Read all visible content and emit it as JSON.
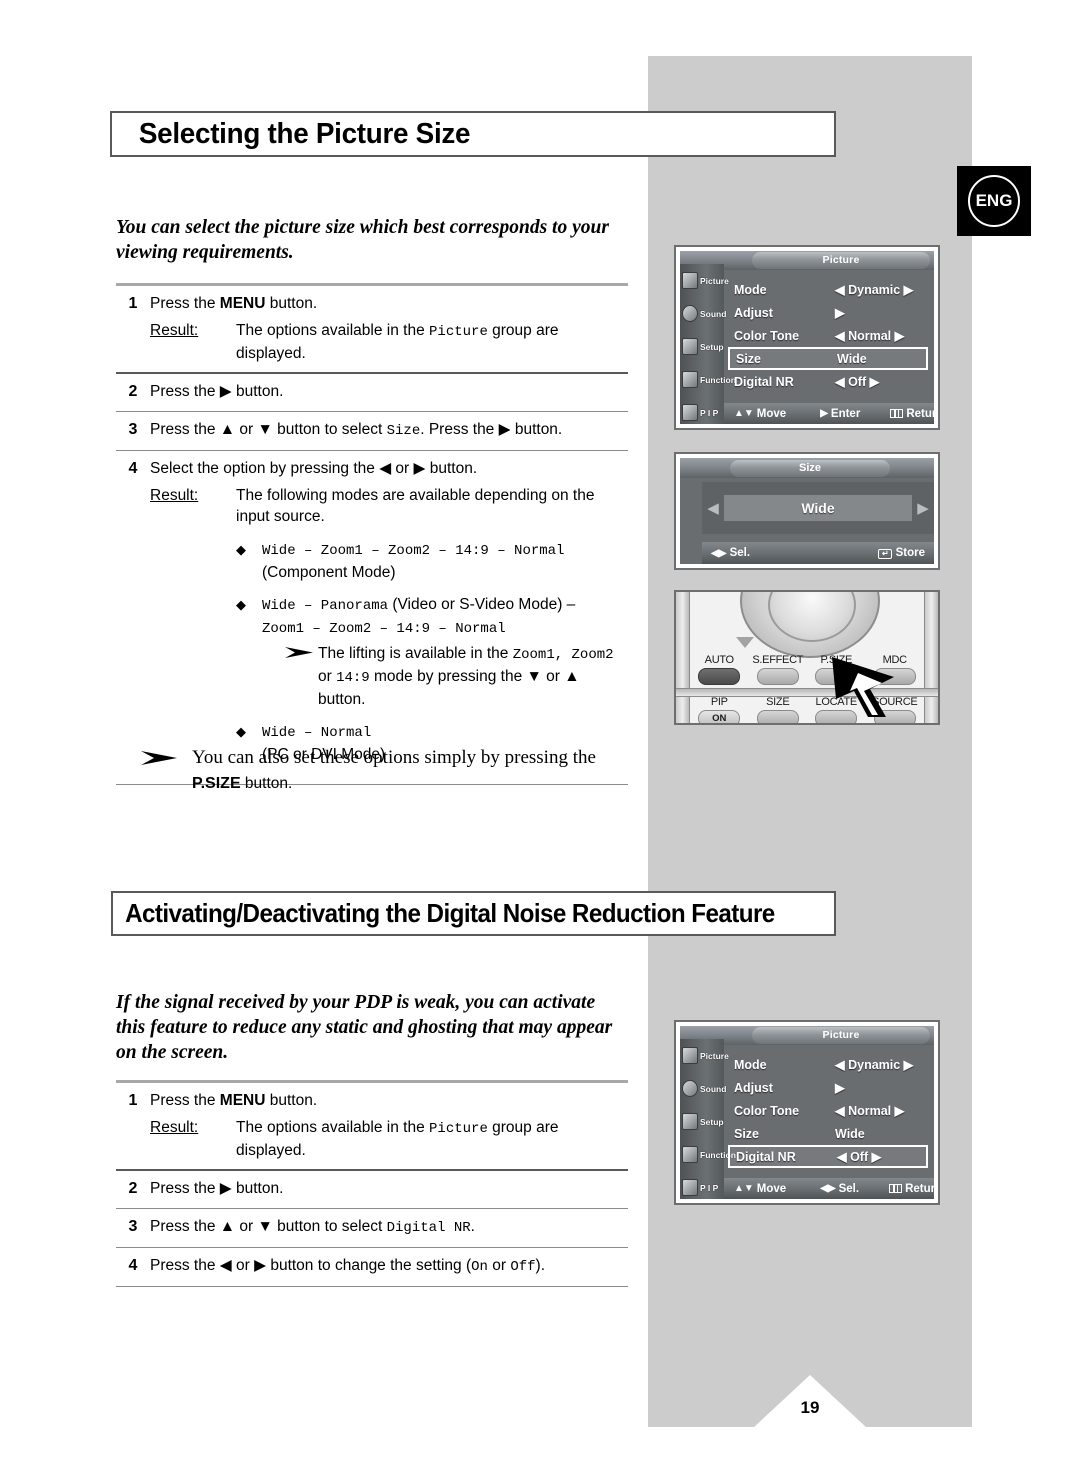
{
  "page": {
    "number": "19",
    "language_badge": "ENG"
  },
  "sections": [
    {
      "title": "Selecting the Picture Size",
      "intro": "You can select the picture size which best corresponds to your viewing requirements.",
      "steps": [
        {
          "num": "1",
          "text_parts": [
            "Press the ",
            "MENU",
            " button."
          ],
          "result_label": "Result:",
          "result_parts": [
            "The options available in the ",
            "Picture",
            " group are displayed."
          ]
        },
        {
          "num": "2",
          "text": "Press the ▶ button."
        },
        {
          "num": "3",
          "text_parts": [
            "Press the ▲ or ▼ button to select ",
            "Size",
            ". Press the ▶ button."
          ]
        },
        {
          "num": "4",
          "text": "Select the option by pressing the ◀ or ▶ button.",
          "result_label": "Result:",
          "result_text": "The following modes are available depending on the input source.",
          "bullets": [
            {
              "mono": "Wide – Zoom1 – Zoom2 – 14:9 – Normal",
              "plain": "(Component Mode)"
            },
            {
              "mono_a": "Wide – Panorama",
              "plain_a": " (Video or S-Video Mode) –",
              "mono_b": "Zoom1 – Zoom2 – 14:9 – Normal",
              "note_parts": [
                "The lifting is available in the ",
                "Zoom1, Zoom2",
                " or ",
                "14:9",
                " mode by pressing the ▼ or ▲ button."
              ]
            },
            {
              "mono": "Wide – Normal",
              "plain": "(PC or DVI Mode)"
            }
          ]
        }
      ],
      "tip": {
        "line1": "You can also set these options simply by pressing the",
        "bold": "P.SIZE",
        "line2_suffix": " button."
      }
    },
    {
      "title": "Activating/Deactivating the Digital Noise Reduction Feature",
      "intro": "If the signal received by your PDP is weak, you can activate this feature to reduce any static and ghosting that may appear on the screen.",
      "steps": [
        {
          "num": "1",
          "text_parts": [
            "Press the ",
            "MENU",
            " button."
          ],
          "result_label": "Result:",
          "result_parts": [
            "The options available in the ",
            "Picture",
            " group are displayed."
          ]
        },
        {
          "num": "2",
          "text": "Press the ▶ button."
        },
        {
          "num": "3",
          "text_parts": [
            "Press the ▲ or ▼ button to select ",
            "Digital NR",
            "."
          ]
        },
        {
          "num": "4",
          "text_parts_4": [
            "Press the ◀ or ▶ button to change the setting (",
            "On",
            " or ",
            "Off",
            ")."
          ]
        }
      ]
    }
  ],
  "osd_picture_menu_1": {
    "title": "Picture",
    "rail": [
      {
        "label": "Picture",
        "icon": "picture-icon"
      },
      {
        "label": "Sound",
        "icon": "sound-icon"
      },
      {
        "label": "Setup",
        "icon": "setup-icon"
      },
      {
        "label": "Function",
        "icon": "function-icon"
      },
      {
        "label": "P I P",
        "icon": "pip-icon"
      }
    ],
    "rows": [
      {
        "label": "Mode",
        "value": "◀  Dynamic  ▶",
        "highlight": false
      },
      {
        "label": "Adjust",
        "value": "▶",
        "highlight": false
      },
      {
        "label": "Color Tone",
        "value": "◀  Normal  ▶",
        "highlight": false
      },
      {
        "label": "Size",
        "value": "Wide",
        "highlight": true
      },
      {
        "label": "Digital NR",
        "value": "◀  Off  ▶",
        "highlight": false
      }
    ],
    "footer": {
      "move": "Move",
      "mid": "Enter",
      "mid_glyph": "▶",
      "return": "Return"
    }
  },
  "osd_size_popup": {
    "title": "Size",
    "value": "Wide",
    "arrow_left": "◀",
    "arrow_right": "▶",
    "footer_left": "Sel.",
    "footer_left_glyph": "◀▶",
    "footer_right": "Store"
  },
  "osd_picture_menu_2": {
    "title": "Picture",
    "rail": [
      {
        "label": "Picture",
        "icon": "picture-icon"
      },
      {
        "label": "Sound",
        "icon": "sound-icon"
      },
      {
        "label": "Setup",
        "icon": "setup-icon"
      },
      {
        "label": "Function",
        "icon": "function-icon"
      },
      {
        "label": "P I P",
        "icon": "pip-icon"
      }
    ],
    "rows": [
      {
        "label": "Mode",
        "value": "◀  Dynamic  ▶",
        "highlight": false
      },
      {
        "label": "Adjust",
        "value": "▶",
        "highlight": false
      },
      {
        "label": "Color Tone",
        "value": "◀  Normal  ▶",
        "highlight": false
      },
      {
        "label": "Size",
        "value": "Wide",
        "highlight": false
      },
      {
        "label": "Digital NR",
        "value": "◀  Off  ▶",
        "highlight": true
      }
    ],
    "footer": {
      "move": "Move",
      "mid": "Sel.",
      "mid_glyph": "◀▶",
      "return": "Return"
    }
  },
  "remote": {
    "row1": [
      {
        "label": "AUTO",
        "style": "dark"
      },
      {
        "label": "S.EFFECT",
        "style": "light"
      },
      {
        "label": "P.SIZE",
        "style": "light"
      },
      {
        "label": "MDC",
        "style": "light"
      }
    ],
    "row2": [
      {
        "label": "PIP",
        "style": "on",
        "cap_text": "ON"
      },
      {
        "label": "SIZE",
        "style": "light"
      },
      {
        "label": "LOCATE",
        "style": "light"
      },
      {
        "label": "SOURCE",
        "style": "light"
      }
    ]
  }
}
